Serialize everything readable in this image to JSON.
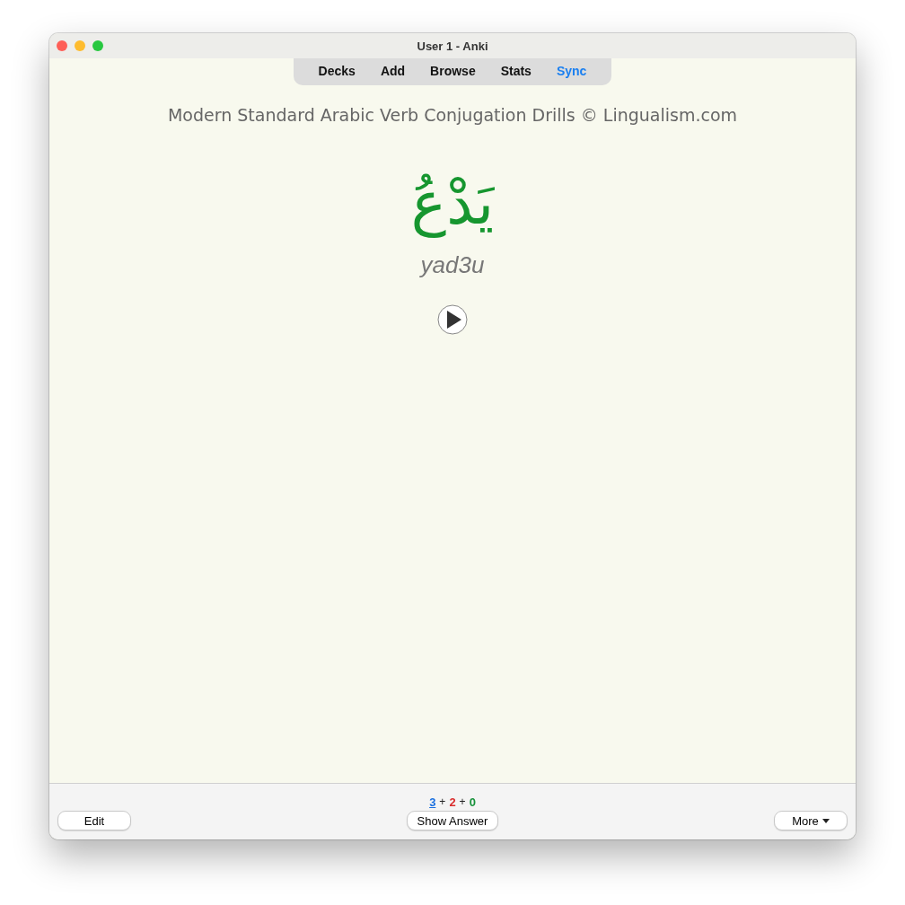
{
  "window": {
    "title": "User 1 - Anki"
  },
  "toolbar": [
    {
      "label": "Decks",
      "selected": false
    },
    {
      "label": "Add",
      "selected": false
    },
    {
      "label": "Browse",
      "selected": false
    },
    {
      "label": "Stats",
      "selected": false
    },
    {
      "label": "Sync",
      "selected": true
    }
  ],
  "card": {
    "header": "Modern Standard Arabic Verb Conjugation Drills © Lingualism.com",
    "word": "يَدْعُ",
    "transliteration": "yad3u"
  },
  "bottom_bar": {
    "edit_button": "Edit",
    "show_answer_button": "Show Answer",
    "more_button": "More",
    "counts": [
      {
        "value": "3",
        "color": "#1a6fdf",
        "current": true
      },
      {
        "value": "2",
        "color": "#d92b2b",
        "current": false
      },
      {
        "value": "0",
        "color": "#16913a",
        "current": false
      }
    ],
    "separator": "+"
  }
}
